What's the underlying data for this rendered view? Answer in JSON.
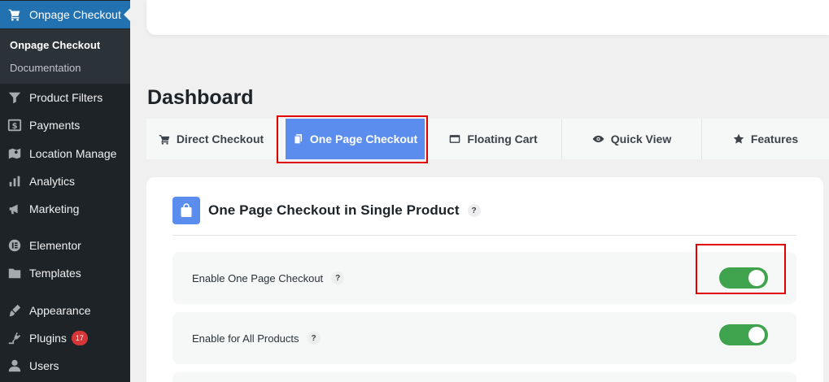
{
  "sidebar": {
    "active_menu": {
      "label": "Onpage Checkout",
      "icon": "cart-icon"
    },
    "submenu": [
      {
        "label": "Onpage Checkout",
        "current": true
      },
      {
        "label": "Documentation",
        "current": false
      }
    ],
    "items": [
      {
        "label": "Product Filters",
        "icon": "filter-icon"
      },
      {
        "label": "Payments",
        "icon": "dollar-icon"
      },
      {
        "label": "Location Manage",
        "icon": "map-icon"
      },
      {
        "label": "Analytics",
        "icon": "bar-chart-icon"
      },
      {
        "label": "Marketing",
        "icon": "megaphone-icon"
      },
      {
        "label": "Elementor",
        "icon": "elementor-icon"
      },
      {
        "label": "Templates",
        "icon": "folder-icon"
      },
      {
        "label": "Appearance",
        "icon": "brush-icon"
      },
      {
        "label": "Plugins",
        "icon": "plug-icon",
        "badge": "17"
      },
      {
        "label": "Users",
        "icon": "user-icon"
      }
    ]
  },
  "page": {
    "title": "Dashboard"
  },
  "tabs": [
    {
      "label": "Direct Checkout",
      "icon": "cart-icon",
      "active": false
    },
    {
      "label": "One Page Checkout",
      "icon": "pages-icon",
      "active": true
    },
    {
      "label": "Floating Cart",
      "icon": "window-icon",
      "active": false
    },
    {
      "label": "Quick View",
      "icon": "eye-icon",
      "active": false
    },
    {
      "label": "Features",
      "icon": "star-icon",
      "active": false
    }
  ],
  "card": {
    "title": "One Page Checkout in Single Product",
    "help": "?",
    "settings": [
      {
        "label": "Enable One Page Checkout",
        "help": "?",
        "enabled": true
      },
      {
        "label": "Enable for All Products",
        "help": "?",
        "enabled": true
      }
    ]
  },
  "colors": {
    "sidebar_bg": "#1d2327",
    "active_menu_bg": "#2271b1",
    "tab_active_bg": "#5b8def",
    "toggle_on": "#3fa34d",
    "highlight_border": "#e00000"
  }
}
